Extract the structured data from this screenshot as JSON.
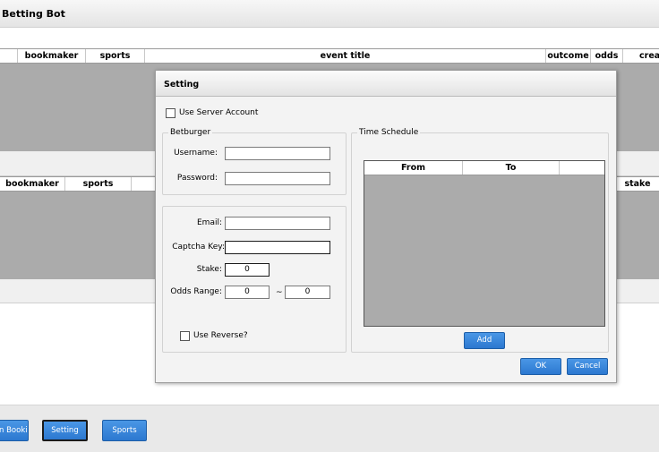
{
  "window": {
    "title": "Betting Bot"
  },
  "top_grid": {
    "columns": [
      "bookmaker",
      "sports",
      "event title",
      "outcome",
      "odds",
      "crea"
    ]
  },
  "bottom_grid": {
    "columns": [
      "bookmaker",
      "sports",
      "stake"
    ]
  },
  "bottom_buttons": {
    "bookie": "n Bookie",
    "setting": "Setting",
    "sports": "Sports"
  },
  "dialog": {
    "title": "Setting",
    "use_server_account": {
      "label": "Use Server Account",
      "checked": false
    },
    "betburger": {
      "legend": "Betburger",
      "username_label": "Username:",
      "username_value": "",
      "password_label": "Password:",
      "password_value": ""
    },
    "account": {
      "email_label": "Email:",
      "email_value": "",
      "captcha_label": "Captcha Key:",
      "captcha_value": "",
      "stake_label": "Stake:",
      "stake_value": "0",
      "odds_range_label": "Odds Range:",
      "odds_min": "0",
      "odds_sep": "~",
      "odds_max": "0",
      "use_reverse": {
        "label": "Use Reverse?",
        "checked": false
      }
    },
    "schedule": {
      "legend": "Time Schedule",
      "columns": [
        "From",
        "To"
      ],
      "add_label": "Add"
    },
    "ok_label": "OK",
    "cancel_label": "Cancel"
  },
  "colors": {
    "button_blue": "#2c78d0",
    "grid_gray": "#ababab"
  }
}
